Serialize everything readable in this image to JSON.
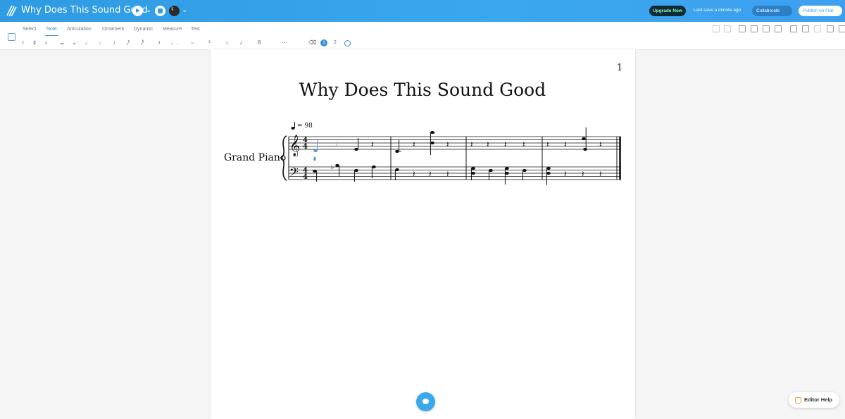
{
  "header": {
    "title": "Why Does This Sound Good",
    "upgrade_label": "Upgrade Now",
    "last_save": "Last save a minute ago",
    "collaborate_label": "Collaborate",
    "publish_label": "Publish on Flat"
  },
  "toolbar": {
    "tabs": [
      "Select",
      "Note",
      "Articulation",
      "Ornament",
      "Dynamic",
      "Measure",
      "Text"
    ],
    "active_tab": "Note",
    "voices": [
      "1",
      "2"
    ]
  },
  "score": {
    "page_number": "1",
    "title": "Why Does This Sound Good",
    "tempo": "= 98",
    "instrument": "Grand Piano"
  },
  "help": {
    "label": "Editor Help"
  },
  "colors": {
    "accent": "#3aa8ec",
    "upgrade_bg": "#0d2a36",
    "upgrade_text": "#8df5b8"
  }
}
